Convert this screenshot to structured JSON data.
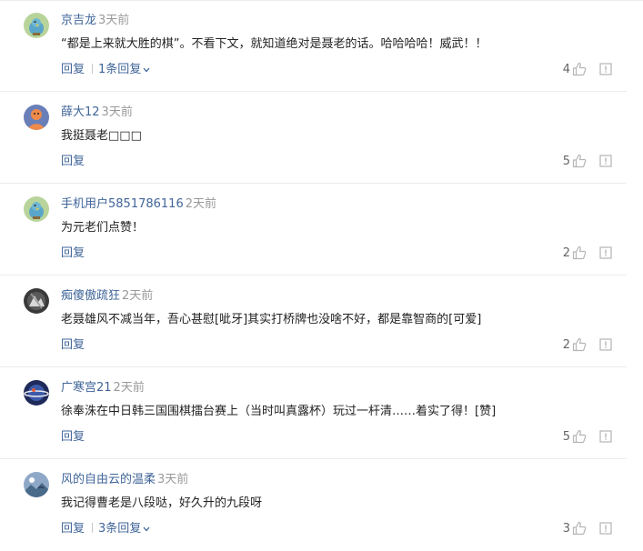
{
  "comments": [
    {
      "username": "京吉龙",
      "time": "3天前",
      "content": "“都是上来就大胜的棋”。不看下文，就知道绝对是聂老的话。哈哈哈哈！威武！！",
      "reply_label": "回复",
      "replies_label": "1条回复",
      "likes": "4",
      "avatar_icon": "parrot-avatar-icon"
    },
    {
      "username": "薛大12",
      "time": "3天前",
      "content": "我挺聂老□□□",
      "reply_label": "回复",
      "likes": "5",
      "avatar_icon": "orange-person-avatar-icon"
    },
    {
      "username": "手机用户5851786116",
      "time": "2天前",
      "content": "为元老们点赞！",
      "reply_label": "回复",
      "likes": "2",
      "avatar_icon": "parrot-avatar-icon"
    },
    {
      "username": "痴傻傲疏狂",
      "time": "2天前",
      "content": "老聂雄风不减当年，吾心甚慰[呲牙]其实打桥牌也没啥不好，都是靠智商的[可爱]",
      "reply_label": "回复",
      "likes": "2",
      "avatar_icon": "dark-photo-avatar-icon"
    },
    {
      "username": "广寒宫21",
      "time": "2天前",
      "content": "徐奉洙在中日韩三国围棋擂台赛上（当时叫真露杯）玩过一杆清……着实了得！[赞]",
      "reply_label": "回复",
      "likes": "5",
      "avatar_icon": "planet-avatar-icon"
    },
    {
      "username": "风的自由云的温柔",
      "time": "3天前",
      "content": "我记得曹老是八段哒，好久升的九段呀",
      "reply_label": "回复",
      "replies_label": "3条回复",
      "likes": "3",
      "avatar_icon": "landscape-avatar-icon"
    }
  ],
  "colors": {
    "username": "#406599",
    "time": "#999999",
    "text": "#222222",
    "divider": "#ececec",
    "icon": "#b5b5b5"
  }
}
